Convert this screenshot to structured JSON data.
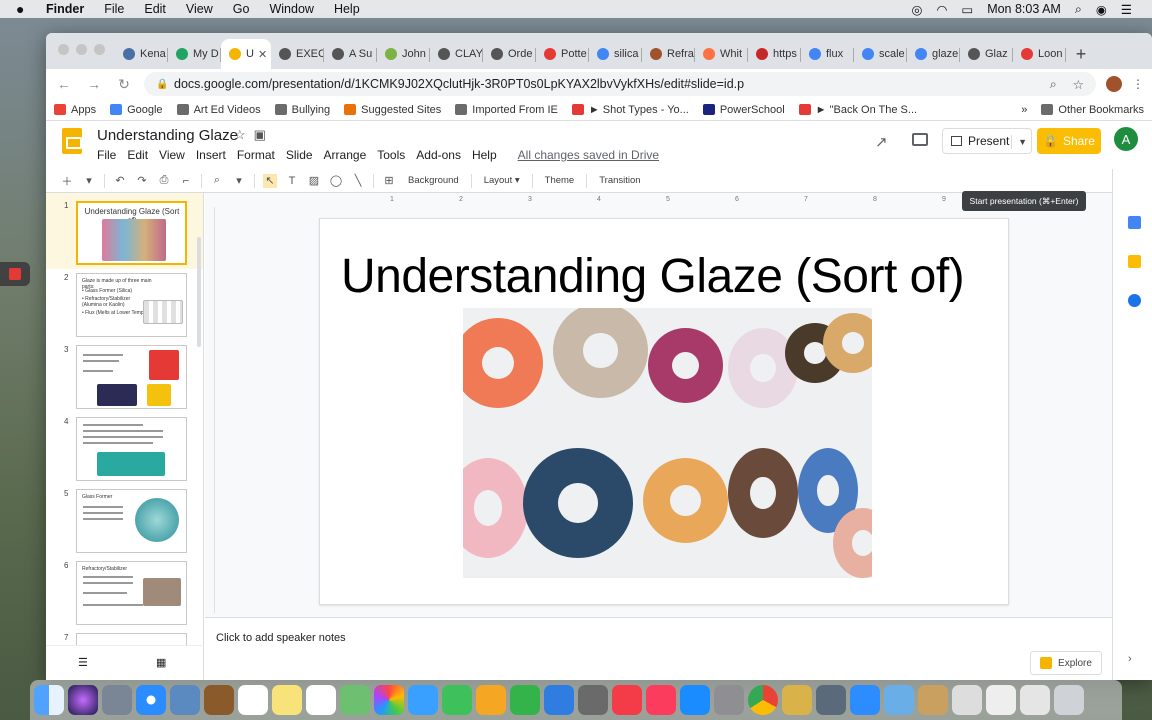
{
  "menubar": {
    "app": "Finder",
    "items": [
      "File",
      "Edit",
      "View",
      "Go",
      "Window",
      "Help"
    ],
    "clock": "Mon 8:03 AM"
  },
  "tabs": [
    {
      "label": "Kena",
      "color": "#4a6fa5"
    },
    {
      "label": "My D",
      "color": "#1fa463"
    },
    {
      "label": "U",
      "color": "#f4b400",
      "active": true
    },
    {
      "label": "EXEC",
      "color": "#555555"
    },
    {
      "label": "A Su",
      "color": "#555555"
    },
    {
      "label": "John",
      "color": "#7cb342"
    },
    {
      "label": "CLAY",
      "color": "#555555"
    },
    {
      "label": "Orde",
      "color": "#555555"
    },
    {
      "label": "Potte",
      "color": "#e53935"
    },
    {
      "label": "silica",
      "color": "#4285f4"
    },
    {
      "label": "Refra",
      "color": "#a0522d"
    },
    {
      "label": "Whit",
      "color": "#ff7043"
    },
    {
      "label": "https",
      "color": "#c62828"
    },
    {
      "label": "flux",
      "color": "#4285f4"
    },
    {
      "label": "scale",
      "color": "#4285f4"
    },
    {
      "label": "glaze",
      "color": "#4285f4"
    },
    {
      "label": "Glaz",
      "color": "#555555"
    },
    {
      "label": "Loon",
      "color": "#e53935"
    }
  ],
  "omnibox": {
    "url": "docs.google.com/presentation/d/1KCMK9J02XQclutHjk-3R0PT0s0LpKYAX2lbvVykfXHs/edit#slide=id.p"
  },
  "bookmarks": [
    {
      "label": "Apps",
      "icon": "apps-grid-icon",
      "color": "#ea4335"
    },
    {
      "label": "Google",
      "icon": "google-icon",
      "color": "#4285f4"
    },
    {
      "label": "Art Ed Videos",
      "icon": "folder-icon",
      "color": "#6b6b6b"
    },
    {
      "label": "Bullying",
      "icon": "folder-icon",
      "color": "#6b6b6b"
    },
    {
      "label": "Suggested Sites",
      "icon": "suggested-icon",
      "color": "#e8710a"
    },
    {
      "label": "Imported From IE",
      "icon": "folder-icon",
      "color": "#6b6b6b"
    },
    {
      "label": "► Shot Types - Yo...",
      "icon": "youtube-icon",
      "color": "#e53935"
    },
    {
      "label": "PowerSchool",
      "icon": "powerschool-icon",
      "color": "#1a237e"
    },
    {
      "label": "► \"Back On The S...",
      "icon": "youtube-icon",
      "color": "#e53935"
    }
  ],
  "bookmarks_more": "»",
  "bookmarks_other": "Other Bookmarks",
  "doc": {
    "title": "Understanding Glaze",
    "menu": [
      "File",
      "Edit",
      "View",
      "Insert",
      "Format",
      "Slide",
      "Arrange",
      "Tools",
      "Add-ons",
      "Help"
    ],
    "saved_status": "All changes saved in Drive",
    "present_label": "Present",
    "share_label": "Share",
    "avatar_letter": "A",
    "tooltip": "Start presentation (⌘+Enter)"
  },
  "edit_toolbar": {
    "background": "Background",
    "layout": "Layout ▾",
    "theme": "Theme",
    "transition": "Transition"
  },
  "ruler_ticks": [
    "1",
    "2",
    "3",
    "4",
    "5",
    "6",
    "7",
    "8",
    "9"
  ],
  "slides": [
    {
      "num": "1",
      "title": "Understanding Glaze (Sort of)"
    },
    {
      "num": "2",
      "title": "Glaze is made up of three main parts:",
      "lines": [
        "• Glass Former (Silica)",
        "• Refractory/Stabilizer",
        "  (Alumina or Kaolin)",
        "• Flux (Melts at Lower Temp)"
      ]
    },
    {
      "num": "3",
      "title": "Middle of Glaze - MATTER"
    },
    {
      "num": "4",
      "title": "Flux makes melt"
    },
    {
      "num": "5",
      "title": "Glass Former"
    },
    {
      "num": "6",
      "title": "Refractory/Stabilizer"
    },
    {
      "num": "7",
      "title": ""
    }
  ],
  "canvas": {
    "slide_title": "Understanding Glaze (Sort of)",
    "speaker_notes_placeholder": "Click to add speaker notes",
    "explore_label": "Explore"
  },
  "colors": {
    "accent": "#f4b400",
    "share": "#fbbc04",
    "avatar": "#1e8e3e"
  }
}
